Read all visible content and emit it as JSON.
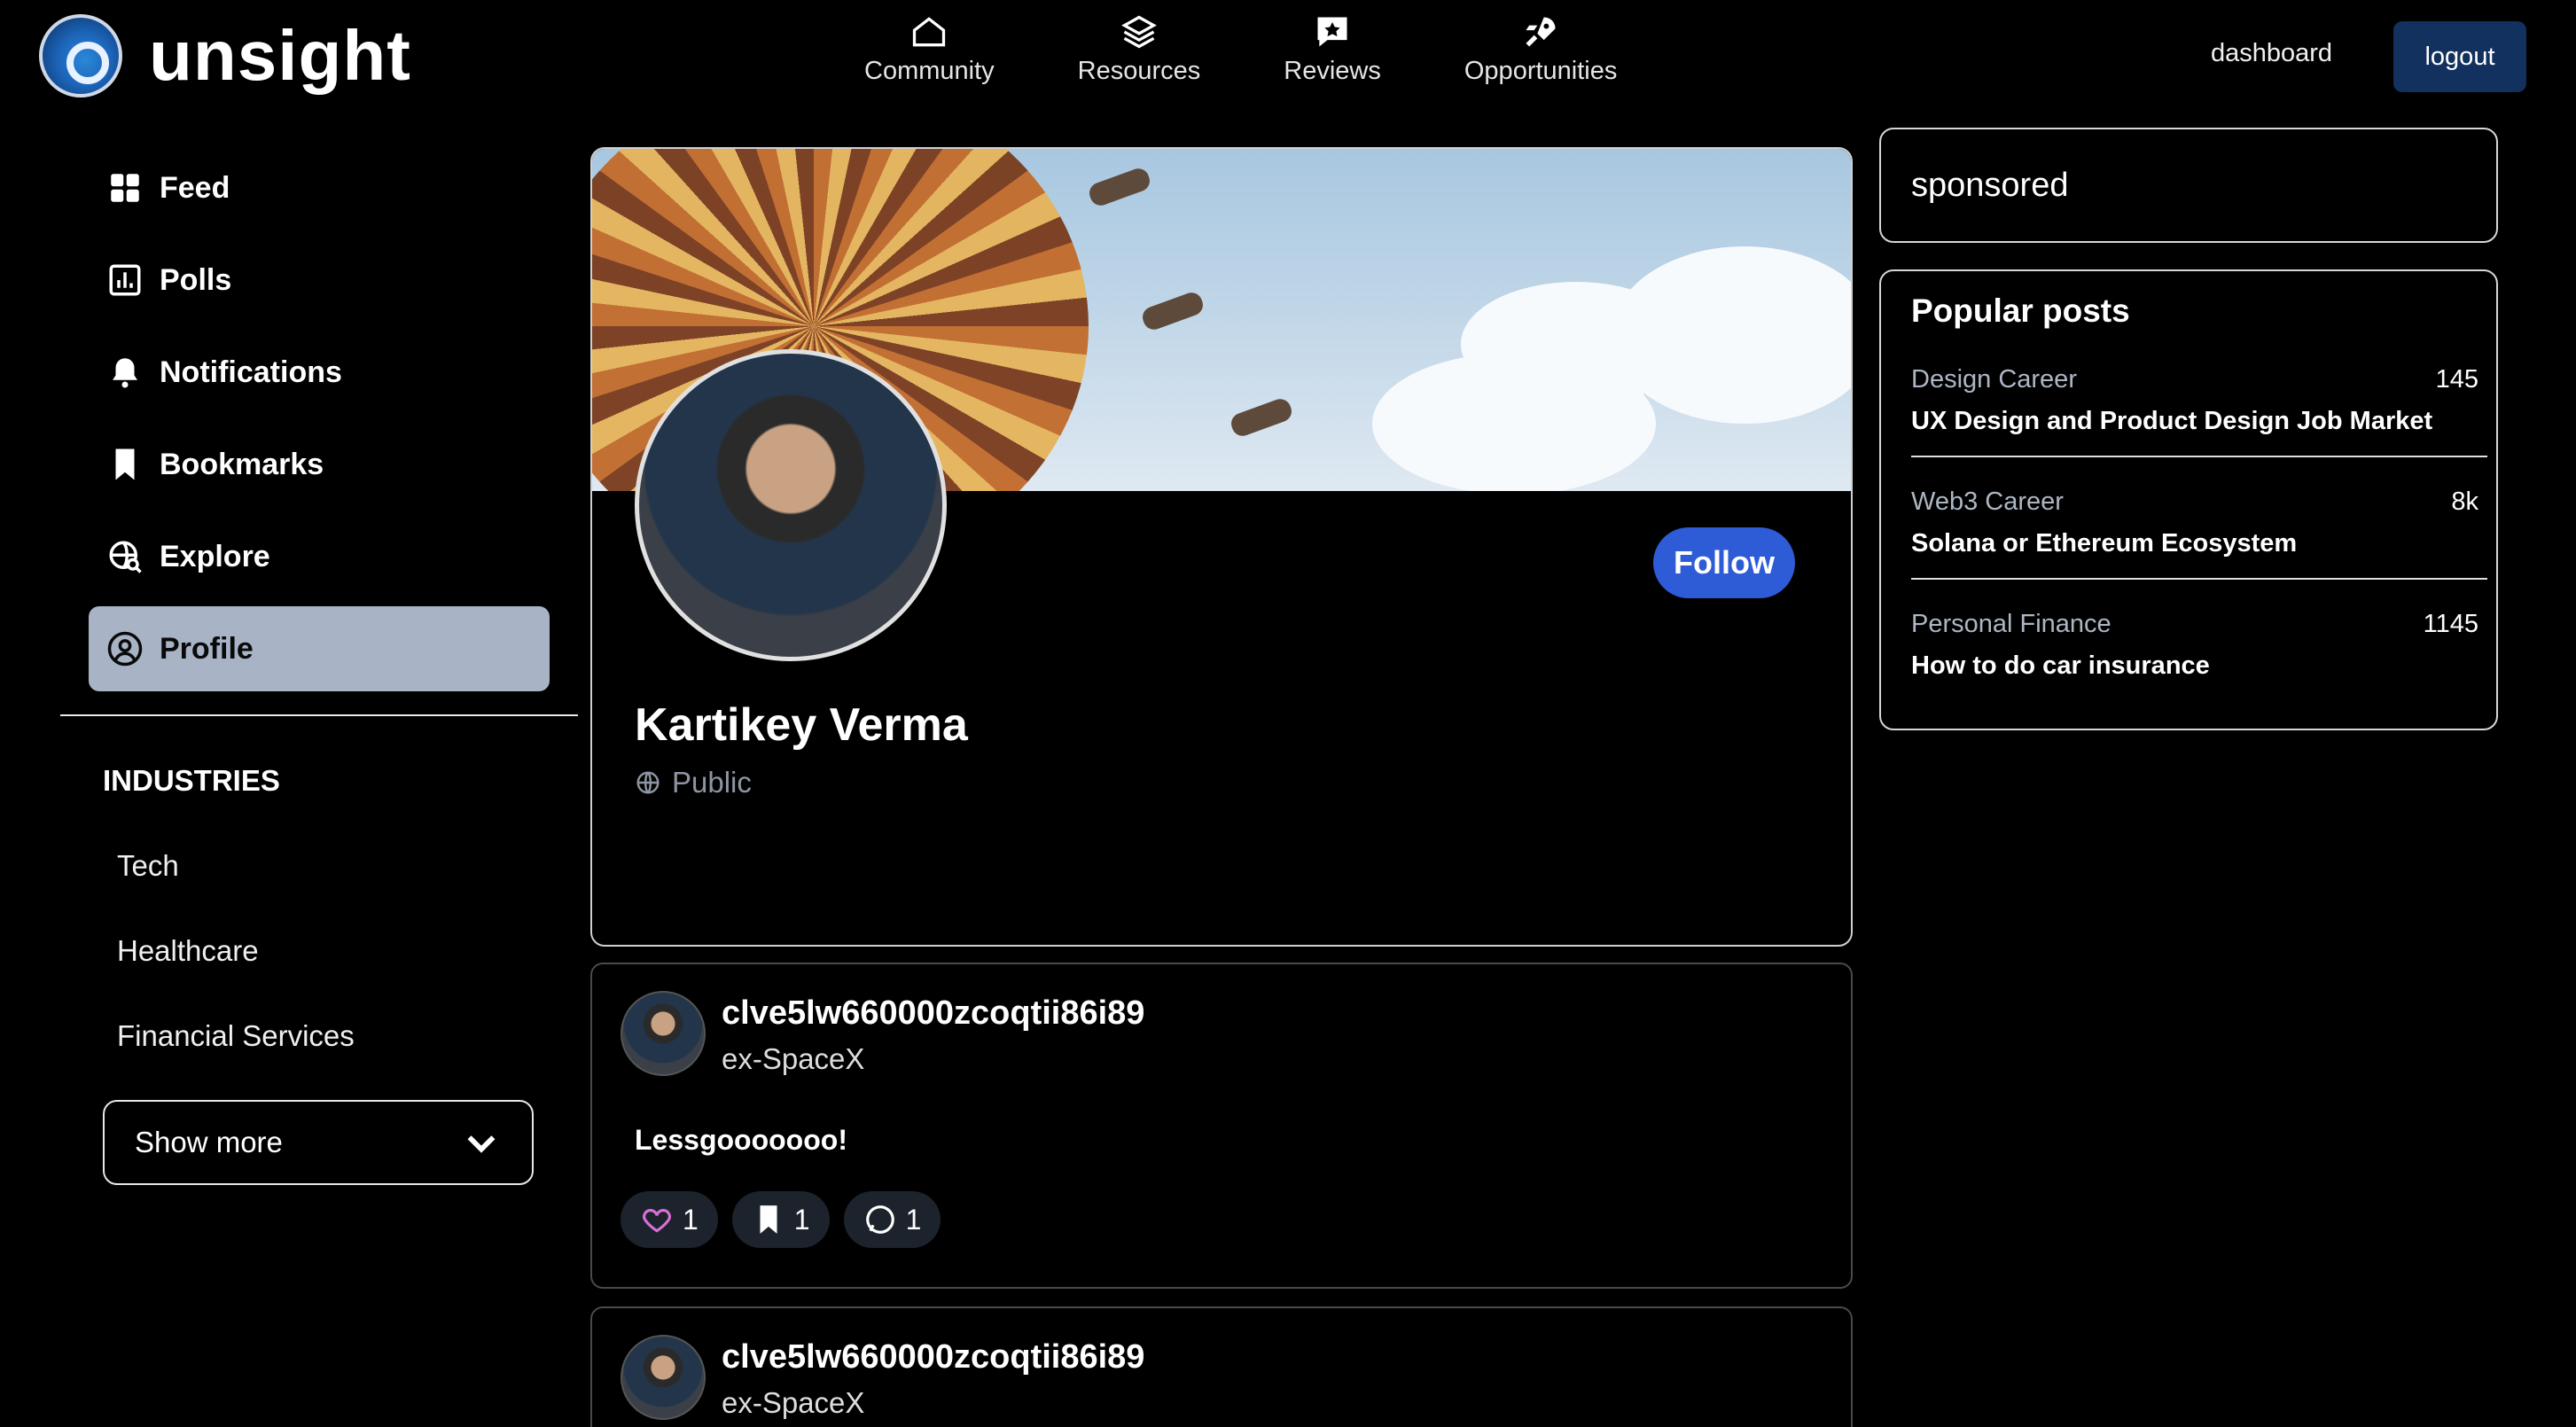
{
  "brand": {
    "name": "unsight"
  },
  "topnav": [
    {
      "label": "Community",
      "icon": "home-icon"
    },
    {
      "label": "Resources",
      "icon": "layers-icon"
    },
    {
      "label": "Reviews",
      "icon": "review-icon"
    },
    {
      "label": "Opportunities",
      "icon": "rocket-icon"
    }
  ],
  "header": {
    "dashboard_label": "dashboard",
    "logout_label": "logout",
    "logout_color": "#12315e"
  },
  "sidebar": {
    "items": [
      {
        "label": "Feed",
        "icon": "grid-icon",
        "active": false
      },
      {
        "label": "Polls",
        "icon": "poll-icon",
        "active": false
      },
      {
        "label": "Notifications",
        "icon": "bell-icon",
        "active": false
      },
      {
        "label": "Bookmarks",
        "icon": "bookmark-icon",
        "active": false
      },
      {
        "label": "Explore",
        "icon": "globe-search-icon",
        "active": false
      },
      {
        "label": "Profile",
        "icon": "user-circle-icon",
        "active": true
      }
    ],
    "industries_title": "INDUSTRIES",
    "industries": [
      "Tech",
      "Healthcare",
      "Financial Services"
    ],
    "show_more_label": "Show more"
  },
  "profile": {
    "name": "Kartikey Verma",
    "visibility": "Public",
    "follow_label": "Follow",
    "follow_color": "#2e5bd6"
  },
  "posts": [
    {
      "username": "clve5lw660000zcoqtii86i89",
      "subtitle": "ex-SpaceX",
      "body": "Lessgooooooo!",
      "likes": "1",
      "bookmarks": "1",
      "comments": "1"
    },
    {
      "username": "clve5lw660000zcoqtii86i89",
      "subtitle": "ex-SpaceX"
    }
  ],
  "right": {
    "sponsored_label": "sponsored",
    "popular_title": "Popular posts",
    "popular": [
      {
        "category": "Design Career",
        "count": "145",
        "title": "UX Design and Product Design Job Market"
      },
      {
        "category": "Web3 Career",
        "count": "8k",
        "title": "Solana or Ethereum Ecosystem"
      },
      {
        "category": "Personal Finance",
        "count": "1145",
        "title": "How to do car insurance"
      }
    ]
  }
}
